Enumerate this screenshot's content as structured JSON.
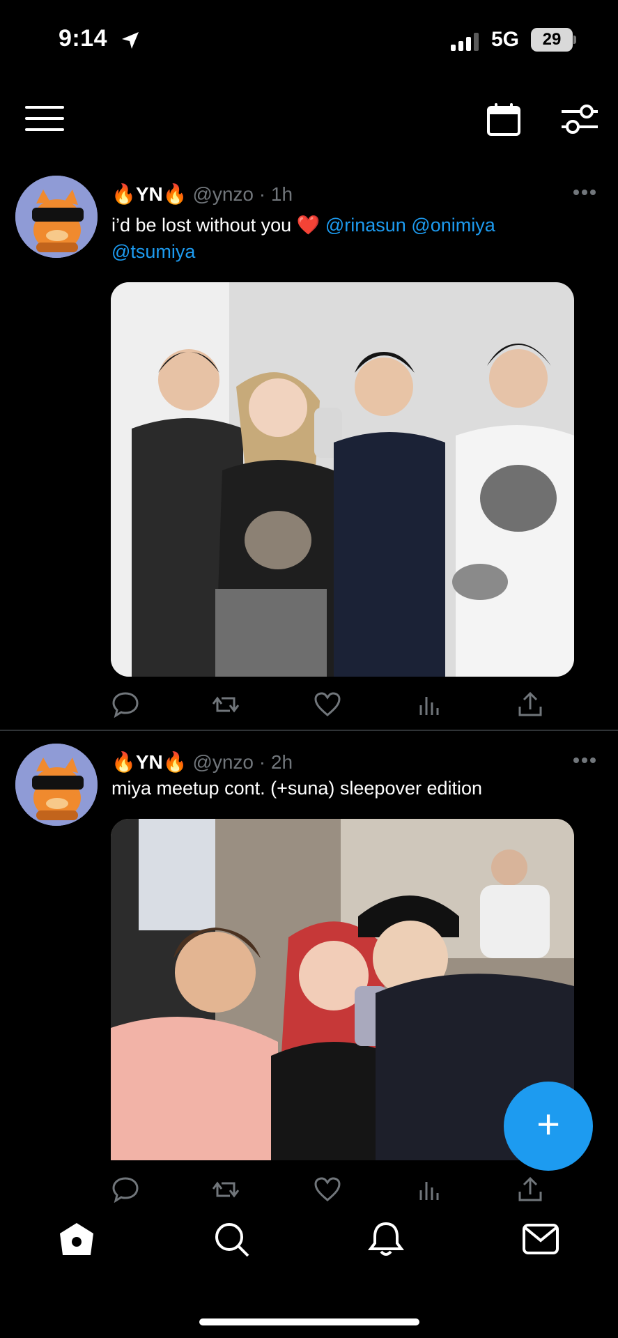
{
  "status_bar": {
    "time": "9:14",
    "network": "5G",
    "battery": "29"
  },
  "colors": {
    "accent": "#1d9bf0",
    "background": "#000000",
    "muted_text": "#71767b",
    "divider": "#2f3336"
  },
  "top_nav": {
    "icons": [
      "menu-icon",
      "calendar-icon",
      "filter-icon"
    ]
  },
  "tweets": [
    {
      "name_prefix_emoji": "🔥",
      "name": "YN",
      "name_suffix_emoji": "🔥",
      "handle": "@ynzo",
      "separator": "·",
      "time": "1h",
      "text": "i’d be lost without you",
      "emoji": "❤️",
      "mentions": [
        "@rinasun",
        "@onimiya",
        "@tsumiya"
      ],
      "image": "group photo of four people holding cats"
    },
    {
      "name_prefix_emoji": "🔥",
      "name": "YN",
      "name_suffix_emoji": "🔥",
      "handle": "@ynzo",
      "separator": "·",
      "time": "2h",
      "text": "miya meetup cont. (+suna) sleepover edition",
      "image": "mirror selfie of four people"
    }
  ],
  "actions": [
    "reply-icon",
    "retweet-icon",
    "like-icon",
    "views-icon",
    "share-icon"
  ],
  "fab": {
    "label": "+"
  },
  "tab_bar": {
    "items": [
      "home-icon",
      "search-icon",
      "notifications-icon",
      "messages-icon"
    ]
  }
}
